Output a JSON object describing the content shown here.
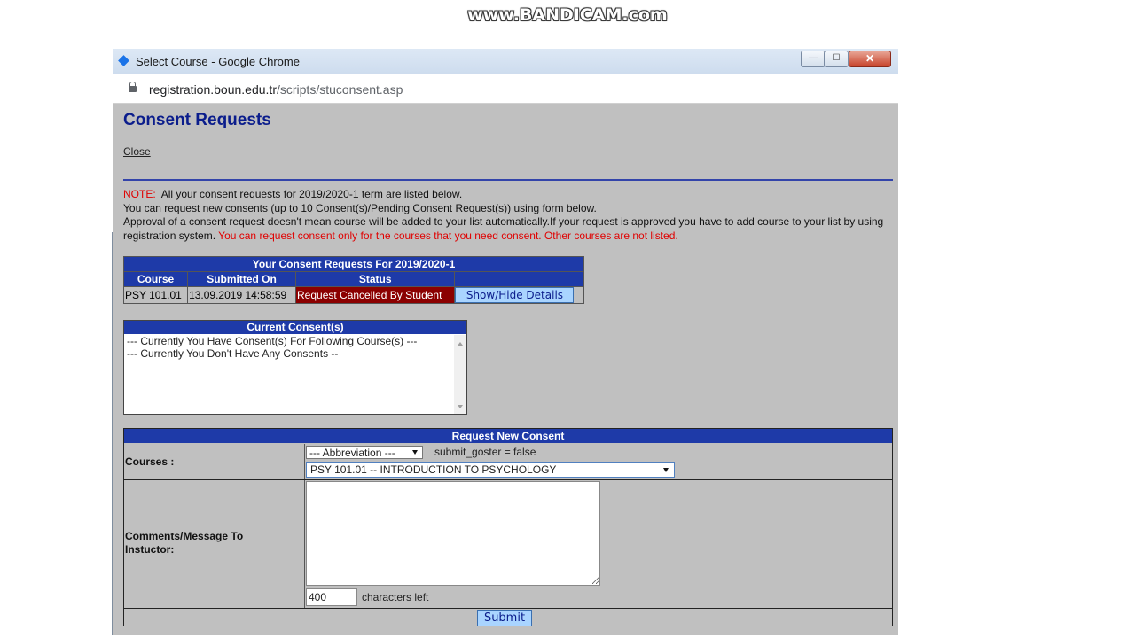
{
  "watermark": "www.BANDICAM.com",
  "window": {
    "title": "Select Course - Google Chrome",
    "url_host": "registration.boun.edu.tr",
    "url_path": "/scripts/stuconsent.asp",
    "controls": {
      "minimize": "—",
      "maximize": "☐",
      "close": "✕"
    }
  },
  "page": {
    "title": "Consent Requests",
    "close_link": "Close",
    "note": {
      "label": "NOTE:",
      "line1": "All your consent requests for 2019/2020-1 term are listed below.",
      "line2": "You can request new consents (up to 10 Consent(s)/Pending Consent Request(s)) using form below.",
      "line3": "Approval of a consent request doesn't mean course will be added to your list automatically.If your request is approved you have to add course to your list by using registration system.",
      "line3_red": "You can request consent only for the courses that you need consent. Other courses are not listed."
    }
  },
  "requests_table": {
    "title": "Your Consent Requests For 2019/2020-1",
    "headers": [
      "Course",
      "Submitted On",
      "Status",
      ""
    ],
    "rows": [
      {
        "course": "PSY 101.01",
        "submitted": "13.09.2019 14:58:59",
        "status": "Request Cancelled By Student",
        "action": "Show/Hide Details"
      }
    ]
  },
  "current_consents": {
    "title": "Current Consent(s)",
    "items": [
      "--- Currently You Have Consent(s) For Following Course(s) ---",
      "--- Currently You Don't Have Any Consents --"
    ]
  },
  "new_request": {
    "title": "Request New Consent",
    "courses_label": "Courses :",
    "abbreviation_value": "--- Abbreviation ---",
    "debug_text": "submit_goster = false",
    "course_value": "PSY 101.01 -- INTRODUCTION TO PSYCHOLOGY",
    "comments_label": "Comments/Message To Instuctor:",
    "chars_count": "400",
    "chars_left_label": "characters left",
    "submit_label": "Submit"
  },
  "colors": {
    "header_blue": "#1e3aa8",
    "title_navy": "#0b1d8c",
    "note_red": "#e00000",
    "status_darkred": "#8b0000",
    "button_lightblue": "#a9d4ff",
    "page_gray": "#c0c0c0"
  }
}
